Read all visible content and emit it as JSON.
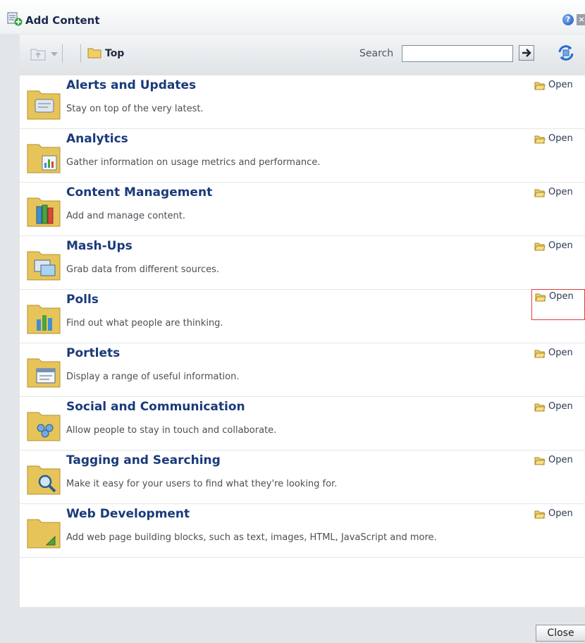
{
  "dialog": {
    "title": "Add Content",
    "help_icon": "help-icon",
    "close_icon": "close-icon"
  },
  "toolbar": {
    "breadcrumb": "Top",
    "search_label": "Search",
    "search_value": "",
    "search_go_icon": "arrow-right-icon",
    "refresh_icon": "refresh-icon"
  },
  "categories": [
    {
      "title": "Alerts and Updates",
      "description": "Stay on top of the very latest.",
      "open_label": "Open",
      "icon": "folder-alerts-icon"
    },
    {
      "title": "Analytics",
      "description": "Gather information on usage metrics and performance.",
      "open_label": "Open",
      "icon": "folder-analytics-icon"
    },
    {
      "title": "Content Management",
      "description": "Add and manage content.",
      "open_label": "Open",
      "icon": "folder-content-management-icon"
    },
    {
      "title": "Mash-Ups",
      "description": "Grab data from different sources.",
      "open_label": "Open",
      "icon": "folder-mashups-icon"
    },
    {
      "title": "Polls",
      "description": "Find out what people are thinking.",
      "open_label": "Open",
      "icon": "folder-polls-icon"
    },
    {
      "title": "Portlets",
      "description": "Display a range of useful information.",
      "open_label": "Open",
      "icon": "folder-portlets-icon"
    },
    {
      "title": "Social and Communication",
      "description": "Allow people to stay in touch and collaborate.",
      "open_label": "Open",
      "icon": "folder-social-icon"
    },
    {
      "title": "Tagging and Searching",
      "description": "Make it easy for your users to find what they're looking for.",
      "open_label": "Open",
      "icon": "folder-search-icon"
    },
    {
      "title": "Web Development",
      "description": "Add web page building blocks, such as text, images, HTML, JavaScript and more.",
      "open_label": "Open",
      "icon": "folder-web-development-icon"
    }
  ],
  "footer": {
    "close_label": "Close"
  },
  "colors": {
    "link": "#1a3a7a",
    "highlight": "#e33b3b",
    "folder": "#e6c45a"
  }
}
